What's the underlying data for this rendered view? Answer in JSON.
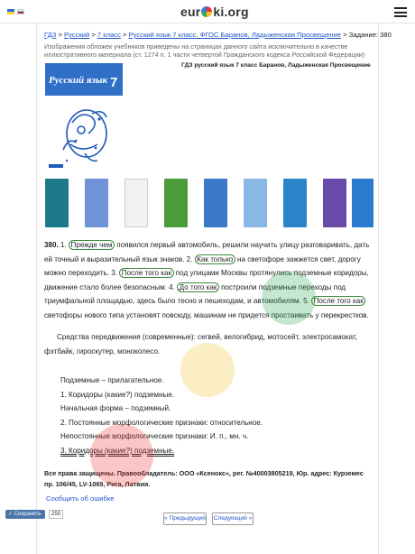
{
  "header": {
    "logo_text_1": "eur",
    "logo_text_2": "ki.org",
    "flags": [
      "ua-flag",
      "ru-flag"
    ],
    "menu_icon": "hamburger-menu-icon"
  },
  "breadcrumb": {
    "items": [
      "ГДЗ",
      "Русский",
      "7 класс",
      "Русский язык 7 класс. ФГОС Баранов, Ладыженская Просвещение"
    ],
    "separator": ">",
    "task_label": "Задание: 380"
  },
  "notice": "Изображения обложек учебников приведены на страницах данного сайта исключительно в качестве иллюстративного материала (ст. 1274 п. 1 части четвертой Гражданского кодекса Российской Федерации)",
  "cover_caption": "ГДЗ русский язык 7 класс Баранов, Ладыженская Просвещение",
  "cover": {
    "title": "Русский язык",
    "grade": "7"
  },
  "thumbnails": [
    {
      "color": "#1c7a8a"
    },
    {
      "color": "#6f93d6"
    },
    {
      "color": "#f2f2f2"
    },
    {
      "color": "#4b9b3a"
    },
    {
      "color": "#3a7ac8"
    },
    {
      "color": "#8ab8e6"
    },
    {
      "color": "#2a84c8"
    },
    {
      "color": "#6a4aa8"
    },
    {
      "color": "#2a7ad0"
    }
  ],
  "exercise": {
    "number": "380.",
    "p1": [
      "1.",
      "Прежде чем",
      "появился первый автомобиль, решили научить улицу разговаривать, дать ей точный и выразительный язык знаков. 2.",
      "Как только",
      "на светофоре зажжется свет, дорогу можно переходить. 3.",
      "После того как",
      "под улицами Москвы протянулись подземные коридоры, движение стало более безопасным. 4.",
      "До того как",
      "построили подземные переходы под триумфальной площадью, здесь было тесно и пешеходам, и автомобилям. 5.",
      "После того как",
      "светофоры нового типа установят повсюду, машинам не придется простаивать у перекрестков."
    ],
    "p2": "Средства передвижения (современные): сегвей, велогибрид, мотосейт, электросамокат, фэтбайк, гироскутер, моноколесо.",
    "analysis": [
      "Подземные – прилагательное.",
      "1. Коридоры (какие?) подземные.",
      "Начальная форма – подземный.",
      "2. Постоянные морфологические признаки: относительное.",
      "Непостоянные морфологические признаки: И. п., мн. ч.",
      "3. Коридоры (какие?) подземные."
    ]
  },
  "footer": {
    "rights": "Все права защищены. Правообладатель: ООО «Ксенокс», рег. №40003805219, Юр. адрес: Курземес пр. 106/45, LV-1069, Рига, Латвия.",
    "report_link": "Сообщить об ошибке",
    "prev_button": "« Предыдущий",
    "next_button": "Следующий »",
    "share_label": "Сохранить",
    "share_count": "255"
  }
}
